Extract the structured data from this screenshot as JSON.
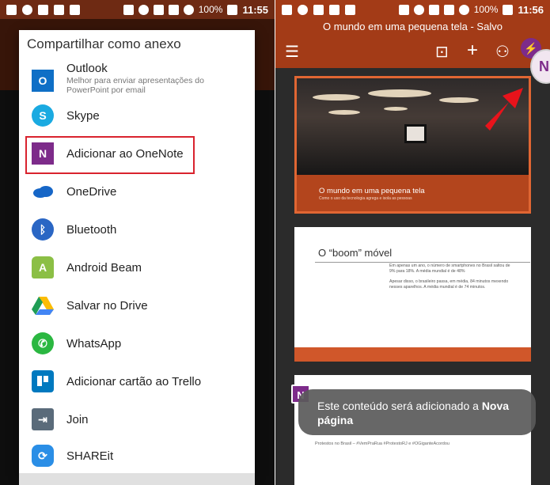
{
  "status_left": {
    "time": "11:55",
    "battery": "100%"
  },
  "status_right": {
    "time": "11:56",
    "battery": "100%"
  },
  "share_sheet": {
    "title": "Compartilhar como anexo",
    "items": [
      {
        "label": "Outlook",
        "subtitle": "Melhor para enviar apresentações do PowerPoint por email",
        "icon": "outlook-icon",
        "color": "#0f6fc6"
      },
      {
        "label": "Skype",
        "icon": "skype-icon",
        "color": "#1aaae1"
      },
      {
        "label": "Adicionar ao OneNote",
        "icon": "onenote-icon",
        "color": "#7d2b8a"
      },
      {
        "label": "OneDrive",
        "icon": "onedrive-icon",
        "color": "#1666c7"
      },
      {
        "label": "Bluetooth",
        "icon": "bluetooth-icon",
        "color": "#2a66c4"
      },
      {
        "label": "Android Beam",
        "icon": "android-beam-icon",
        "color": "#8bbf45"
      },
      {
        "label": "Salvar no Drive",
        "icon": "google-drive-icon",
        "color": "#1f9d55"
      },
      {
        "label": "WhatsApp",
        "icon": "whatsapp-icon",
        "color": "#2bb741"
      },
      {
        "label": "Adicionar cartão ao Trello",
        "icon": "trello-icon",
        "color": "#0079bf"
      },
      {
        "label": "Join",
        "icon": "join-icon",
        "color": "#5a6b7a"
      },
      {
        "label": "SHAREit",
        "icon": "shareit-icon",
        "color": "#2a8ee6"
      }
    ]
  },
  "ppt": {
    "title": "O mundo em uma pequena tela - Salvo",
    "slide1": {
      "title": "O mundo em uma pequena tela",
      "subtitle": "Como o uso da tecnologia agrega e isola as pessoas"
    },
    "slide2": {
      "title": "O “boom” móvel",
      "bullets": [
        "Em apenas um ano, o número de smartphones no Brasil saltou de 9% para 18%. A média mundial é de 48%",
        "Apesar disso, o brasileiro passa, em média, 84 minutos mexendo nesses aparelhos. A média mundial é de 74 minutos."
      ]
    },
    "slide3": {
      "footer": "Protestos no Brasil – #VemPraRua #ProtestoRJ e #OGiganteAcordou"
    },
    "toast": {
      "text": "Este conteúdo será adicionado a ",
      "bold": "Nova página"
    },
    "avatar_letter": "N",
    "onenote_letter": "N"
  }
}
